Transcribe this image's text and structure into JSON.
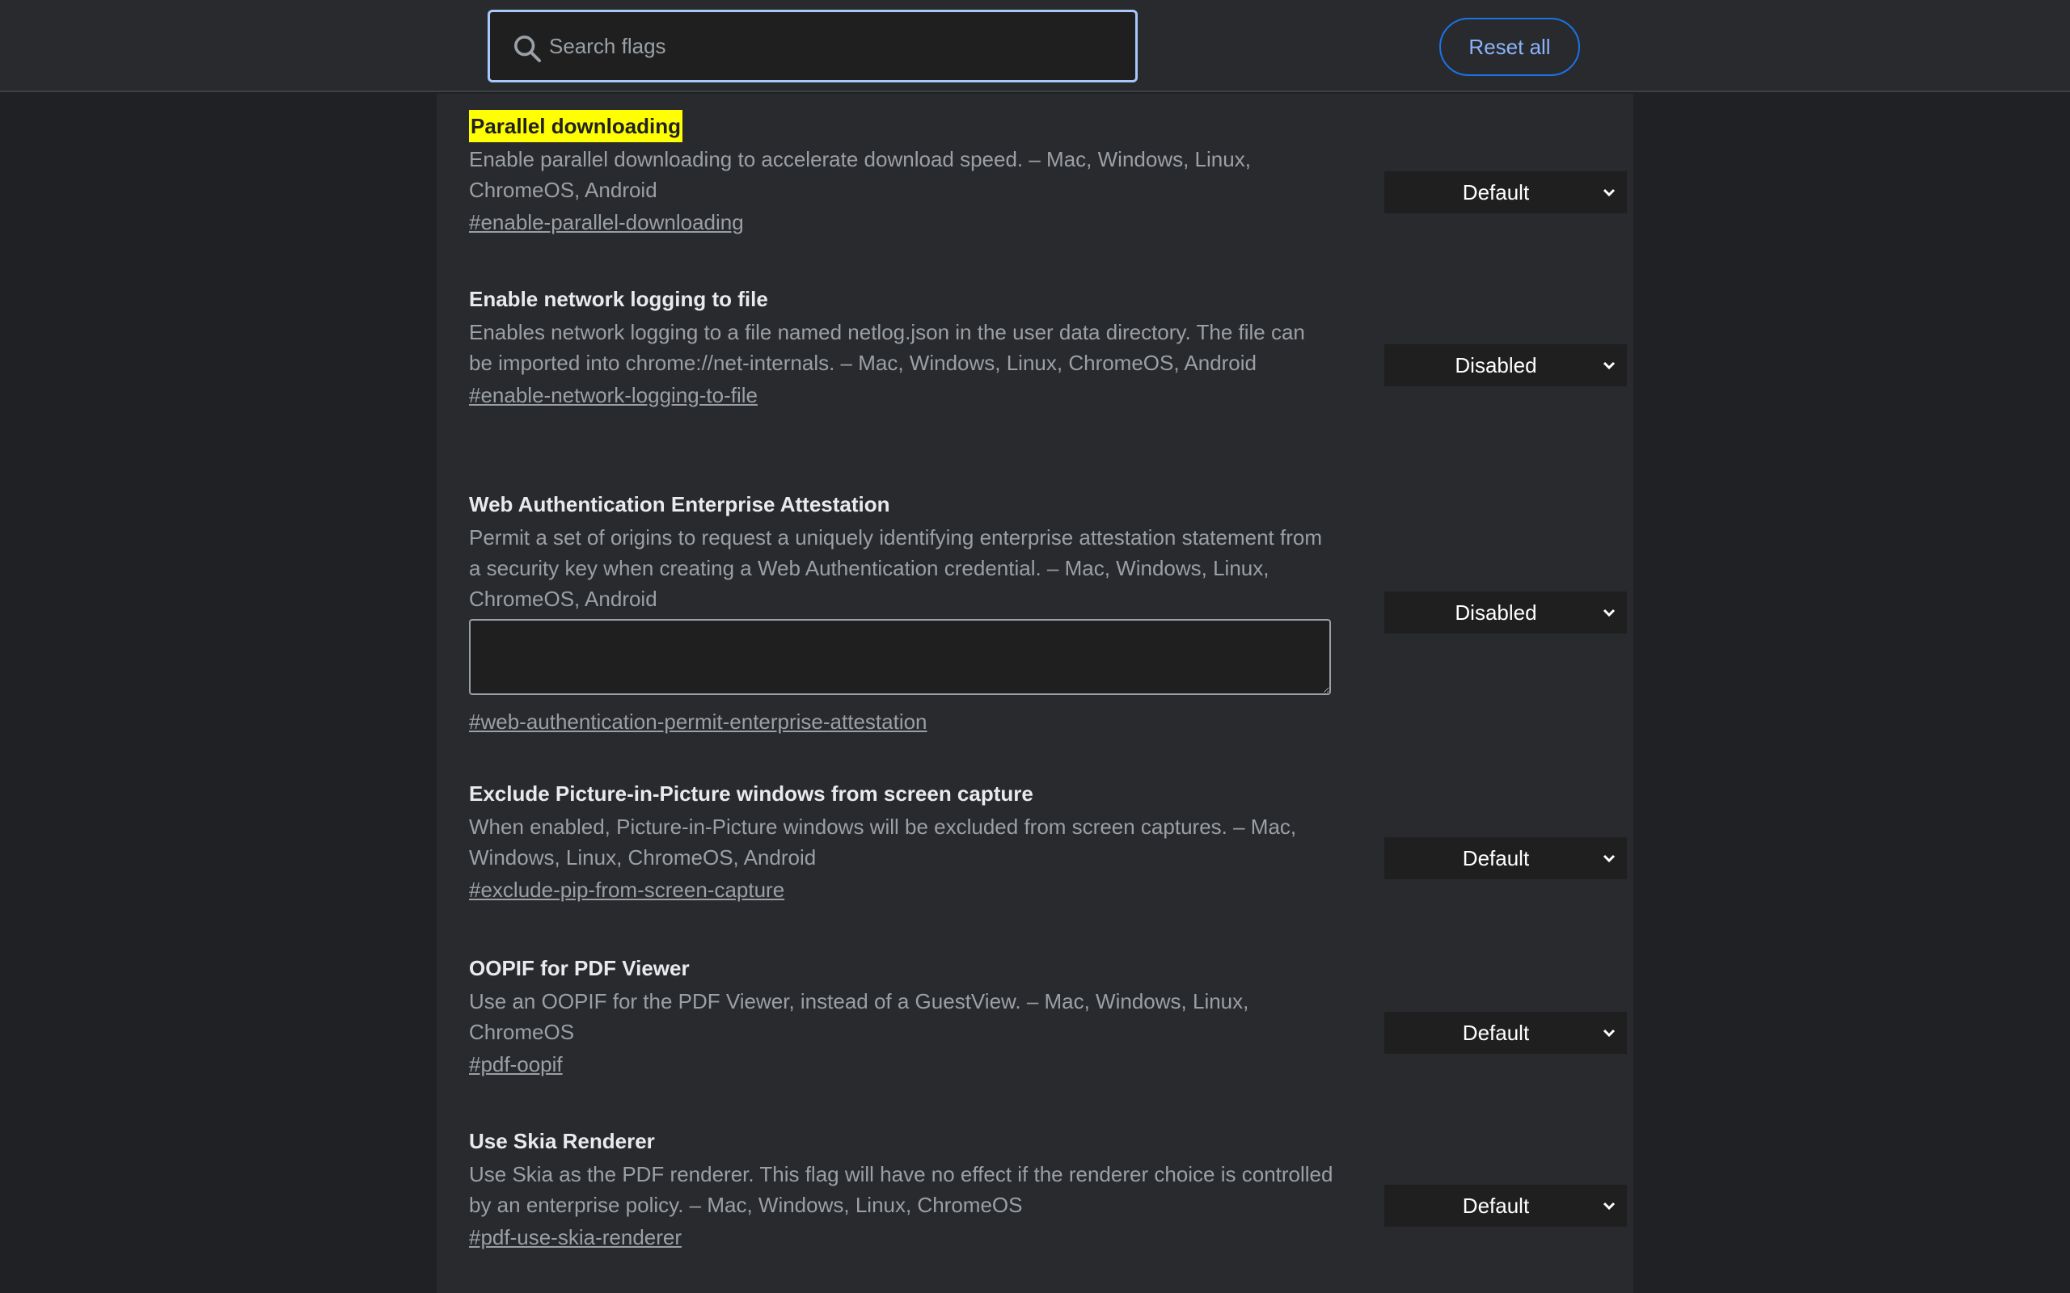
{
  "search": {
    "placeholder": "Search flags",
    "value": ""
  },
  "header": {
    "reset_label": "Reset all"
  },
  "flags": [
    {
      "title": "Parallel downloading",
      "description": "Enable parallel downloading to accelerate download speed. – Mac, Windows, Linux, ChromeOS, Android",
      "link": "#enable-parallel-downloading",
      "value": "Default"
    },
    {
      "title": "Enable network logging to file",
      "description": "Enables network logging to a file named netlog.json in the user data directory. The file can be imported into chrome://net-internals. – Mac, Windows, Linux, ChromeOS, Android",
      "link": "#enable-network-logging-to-file",
      "value": "Disabled"
    },
    {
      "title": "Web Authentication Enterprise Attestation",
      "description": "Permit a set of origins to request a uniquely identifying enterprise attestation statement from a security key when creating a Web Authentication credential. – Mac, Windows, Linux, ChromeOS, Android",
      "textarea_value": "",
      "link": "#web-authentication-permit-enterprise-attestation",
      "value": "Disabled"
    },
    {
      "title": "Exclude Picture-in-Picture windows from screen capture",
      "description": "When enabled, Picture-in-Picture windows will be excluded from screen captures. – Mac, Windows, Linux, ChromeOS, Android",
      "link": "#exclude-pip-from-screen-capture",
      "value": "Default"
    },
    {
      "title": "OOPIF for PDF Viewer",
      "description": "Use an OOPIF for the PDF Viewer, instead of a GuestView. – Mac, Windows, Linux, ChromeOS",
      "link": "#pdf-oopif",
      "value": "Default"
    },
    {
      "title": "Use Skia Renderer",
      "description": "Use Skia as the PDF renderer. This flag will have no effect if the renderer choice is controlled by an enterprise policy. – Mac, Windows, Linux, ChromeOS",
      "link": "#pdf-use-skia-renderer",
      "value": "Default"
    }
  ],
  "colors": {
    "page_bg": "#202124",
    "panel_bg": "#292a2d",
    "accent": "#8ab4f8",
    "highlight": "#ffff00"
  }
}
